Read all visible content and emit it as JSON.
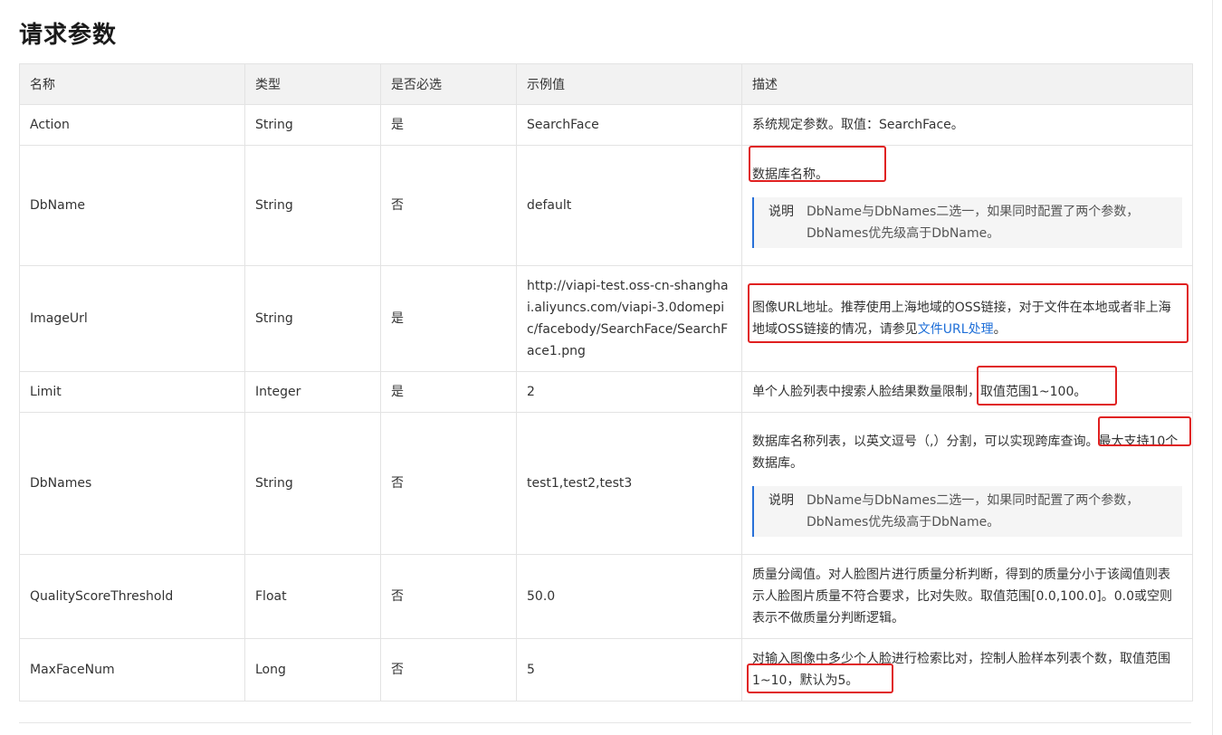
{
  "title": "请求参数",
  "columns": [
    "名称",
    "类型",
    "是否必选",
    "示例值",
    "描述"
  ],
  "rows": [
    {
      "name": "Action",
      "type": "String",
      "required": "是",
      "example": "SearchFace",
      "desc": "系统规定参数。取值：SearchFace。"
    },
    {
      "name": "DbName",
      "type": "String",
      "required": "否",
      "example": "default",
      "desc": "数据库名称。",
      "note_label": "说明",
      "note_text": "DbName与DbNames二选一，如果同时配置了两个参数，DbNames优先级高于DbName。"
    },
    {
      "name": "ImageUrl",
      "type": "String",
      "required": "是",
      "example": "http://viapi-test.oss-cn-shanghai.aliyuncs.com/viapi-3.0domepic/facebody/SearchFace/SearchFace1.png",
      "desc": "图像URL地址。推荐使用上海地域的OSS链接，对于文件在本地或者非上海地域OSS链接的情况，请参见",
      "desc_link": "文件URL处理",
      "desc_end": "。"
    },
    {
      "name": "Limit",
      "type": "Integer",
      "required": "是",
      "example": "2",
      "desc": "单个人脸列表中搜索人脸结果数量限制，取值范围1~100。"
    },
    {
      "name": "DbNames",
      "type": "String",
      "required": "否",
      "example": "test1,test2,test3",
      "desc": "数据库名称列表，以英文逗号（,）分割，可以实现跨库查询。最大支持10个数据库。",
      "note_label": "说明",
      "note_text": "DbName与DbNames二选一，如果同时配置了两个参数，DbNames优先级高于DbName。"
    },
    {
      "name": "QualityScoreThreshold",
      "type": "Float",
      "required": "否",
      "example": "50.0",
      "desc": "质量分阈值。对人脸图片进行质量分析判断，得到的质量分小于该阈值则表示人脸图片质量不符合要求，比对失败。取值范围[0.0,100.0]。0.0或空则表示不做质量分判断逻辑。"
    },
    {
      "name": "MaxFaceNum",
      "type": "Long",
      "required": "否",
      "example": "5",
      "desc": "对输入图像中多少个人脸进行检索比对，控制人脸样本列表个数，取值范围1~10，默认为5。"
    }
  ],
  "colors": {
    "highlight": "#e02020",
    "link": "#1f6fd8",
    "header_bg": "#f2f2f2",
    "note_bar": "#2870d8"
  }
}
